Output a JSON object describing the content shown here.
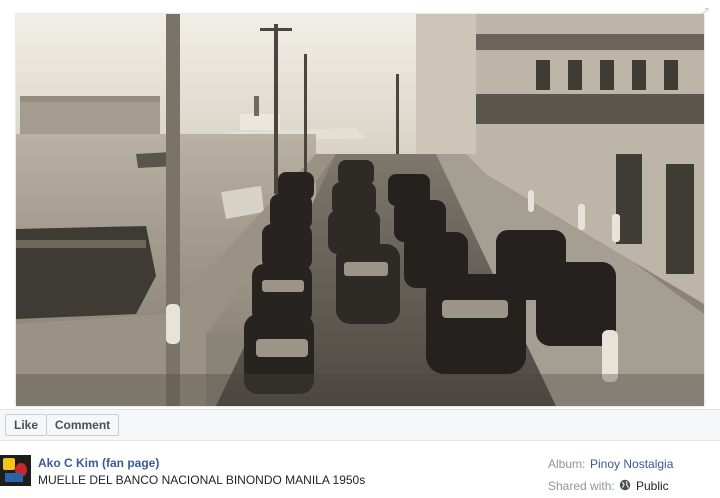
{
  "post": {
    "author": "Ako C Kim (fan page)",
    "caption": "MUELLE DEL BANCO NACIONAL BINONDO MANILA 1950s"
  },
  "actions": {
    "like_label": "Like",
    "comment_label": "Comment"
  },
  "album": {
    "label": "Album:",
    "name": "Pinoy Nostalgia"
  },
  "sharing": {
    "label": "Shared with:",
    "privacy": "Public",
    "privacy_icon": "globe-icon"
  },
  "icons": {
    "expand": "expand-icon"
  },
  "colors": {
    "link": "#3b5998",
    "muted": "#90949c",
    "text": "#1d2129",
    "photo_sepia": "#8a8378"
  }
}
